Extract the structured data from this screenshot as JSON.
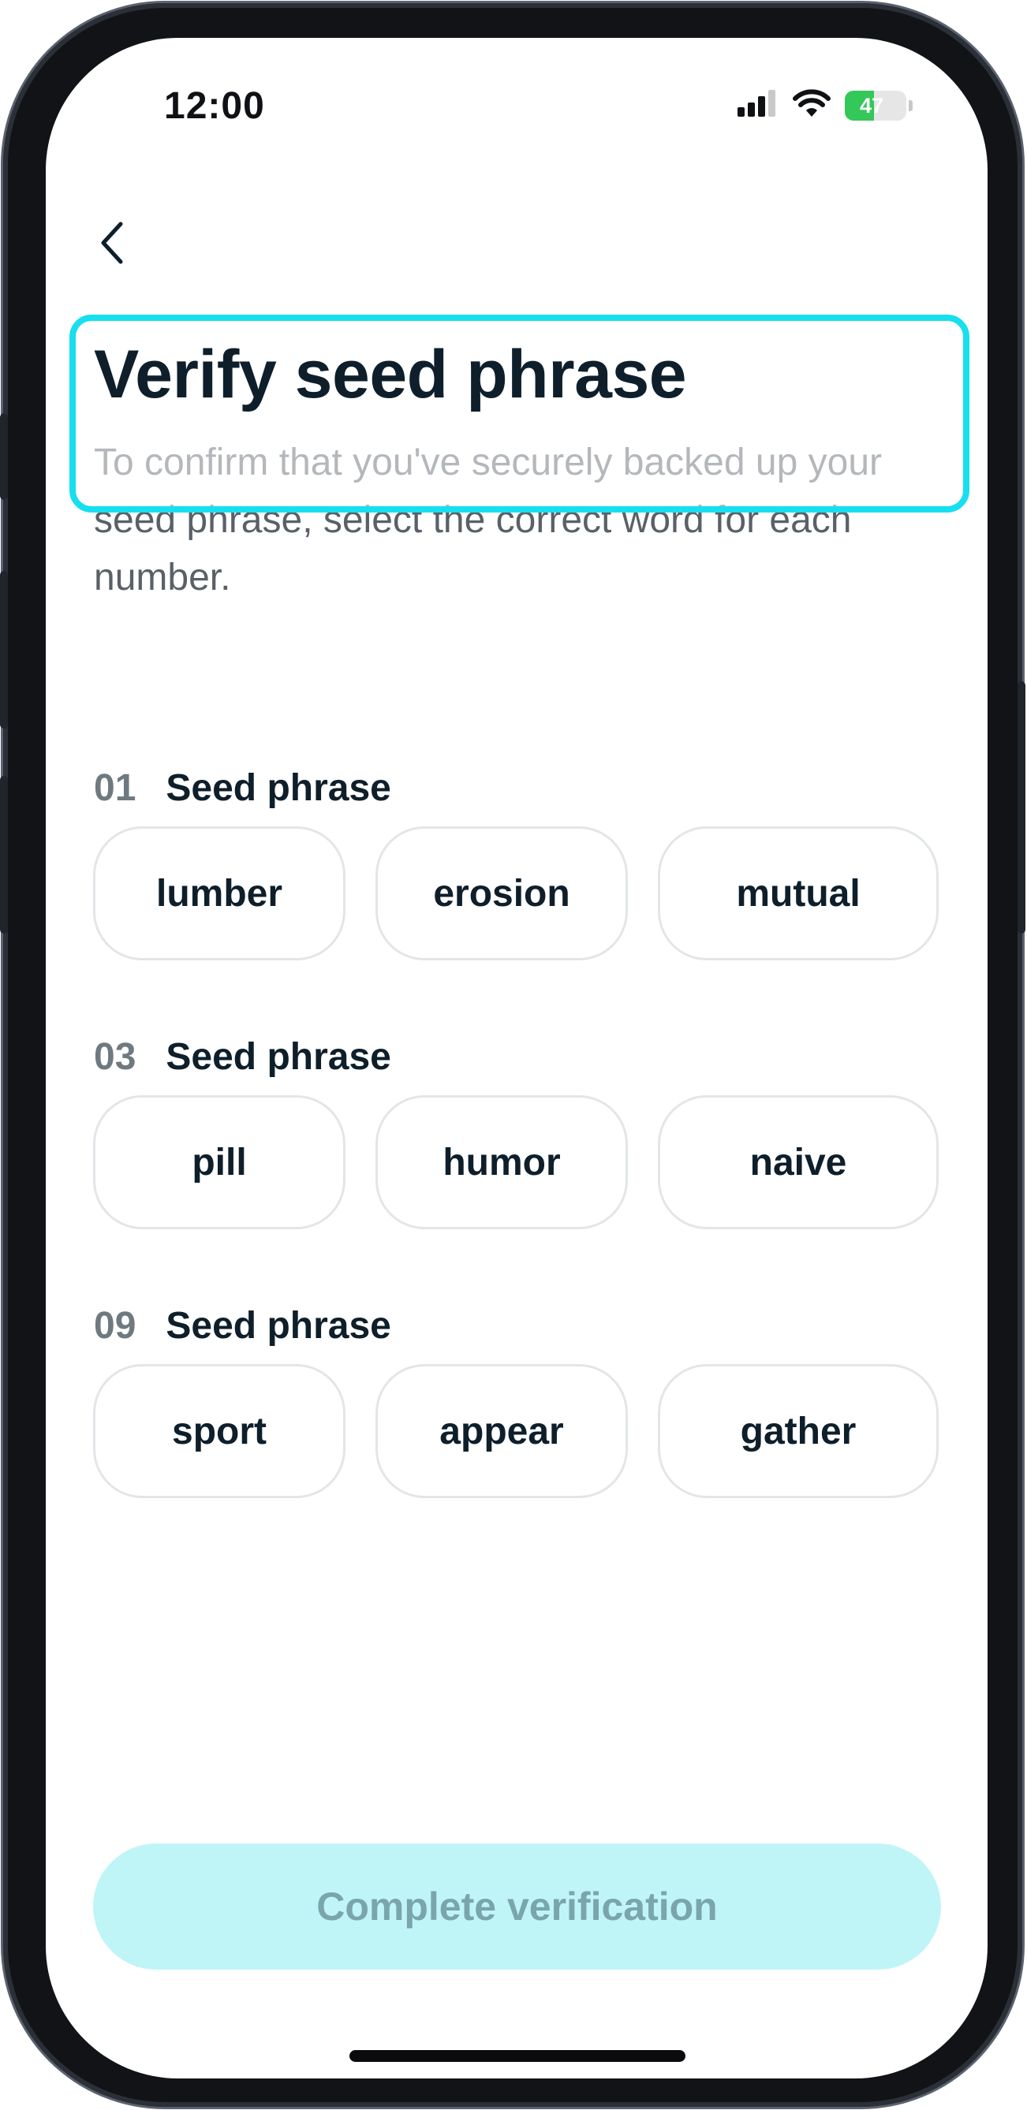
{
  "status_bar": {
    "time": "12:00",
    "battery_percent": "47",
    "battery_level": 0.47,
    "icons": [
      "signal-icon",
      "wifi-icon",
      "battery-icon"
    ]
  },
  "nav": {
    "back_icon": "chevron-left-icon"
  },
  "header": {
    "title": "Verify seed phrase",
    "subtitle": "To confirm that you've securely backed up your seed phrase, select the correct word for each number."
  },
  "sections": [
    {
      "number": "01",
      "label": "Seed phrase",
      "options": [
        "lumber",
        "erosion",
        "mutual"
      ]
    },
    {
      "number": "03",
      "label": "Seed phrase",
      "options": [
        "pill",
        "humor",
        "naive"
      ]
    },
    {
      "number": "09",
      "label": "Seed phrase",
      "options": [
        "sport",
        "appear",
        "gather"
      ]
    }
  ],
  "cta": {
    "label": "Complete verification",
    "enabled": false
  },
  "colors": {
    "accent": "#17dfee",
    "cta_bg": "#c0f5f7",
    "cta_text": "#7aa5ac",
    "title": "#0e1f2b",
    "battery": "#34c759"
  }
}
